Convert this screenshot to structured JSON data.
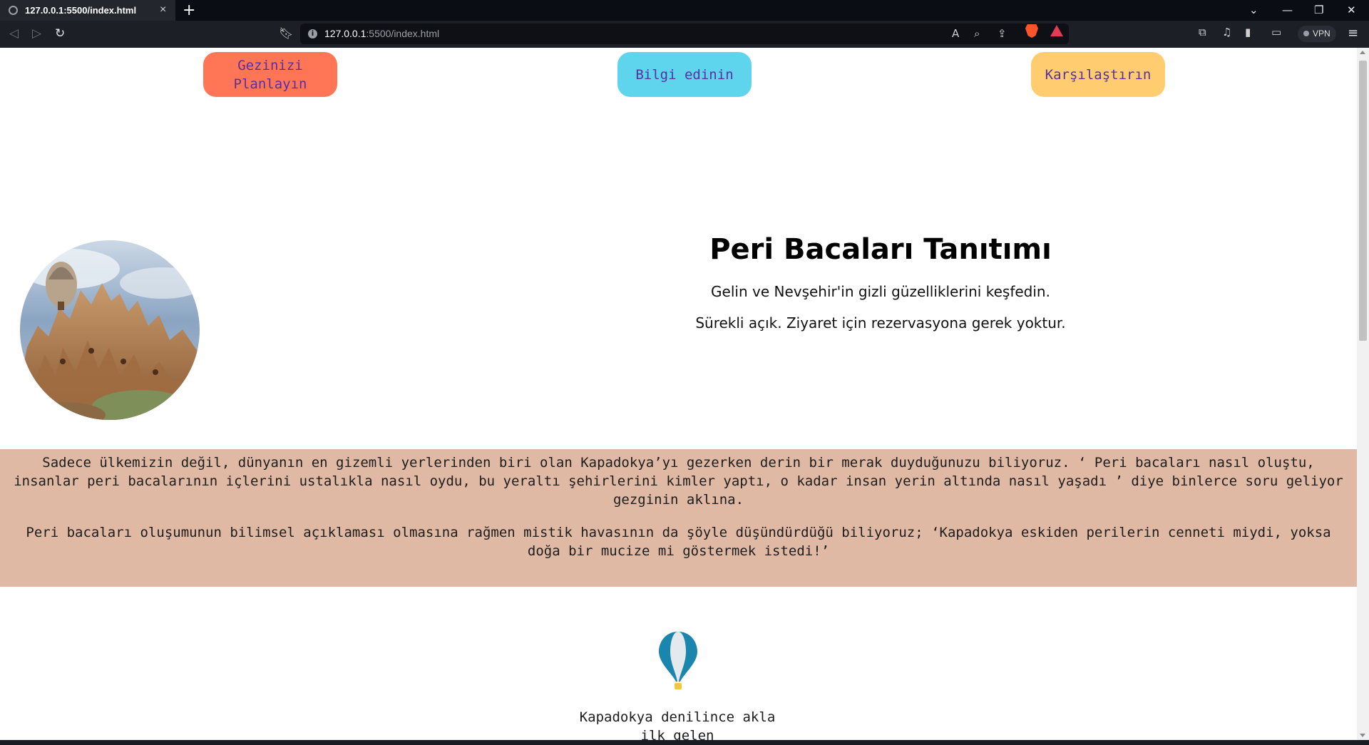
{
  "browser": {
    "tab_title": "127.0.0.1:5500/index.html",
    "tab_close": "×",
    "new_tab": "+",
    "url_host": "127.0.0.1",
    "url_rest": ":5500/index.html",
    "vpn_label": "VPN",
    "window_controls": [
      "⌄",
      "—",
      "❐",
      "✕"
    ]
  },
  "nav": {
    "plan_label": "Gezinizi Planlayın",
    "info_label": "Bilgi edinin",
    "compare_label": "Karşılaştırın",
    "colors": {
      "plan": "#ff7657",
      "info": "#5ed5ec",
      "compare": "#ffcd70",
      "text": "#5b2f9e"
    }
  },
  "hero": {
    "title": "Peri Bacaları Tanıtımı",
    "subtitle_1": "Gelin ve Nevşehir'in gizli güzelliklerini keşfedin.",
    "subtitle_2": "Sürekli açık. Ziyaret için rezervasyona gerek yoktur."
  },
  "story": {
    "paragraph_1": "Sadece ülkemizin değil, dünyanın en gizemli yerlerinden biri olan Kapadokya’yı gezerken derin bir merak duyduğunuzu biliyoruz. ‘ Peri bacaları nasıl oluştu, insanlar peri bacalarının içlerini ustalıkla nasıl oydu, bu yeraltı şehirlerini kimler yaptı, o kadar insan yerin altında nasıl yaşadı ’ diye binlerce soru geliyor gezginin aklına.",
    "paragraph_2": "Peri bacaları oluşumunun bilimsel açıklaması olmasına rağmen mistik havasının da şöyle düşündürdüğü biliyoruz; ‘Kapadokya eskiden perilerin cenneti miydi, yoksa doğa bir mucize mi göstermek istedi!’",
    "background": "#dfb9a4"
  },
  "teaser": {
    "text": "Kapadokya denilince akla ilk gelen"
  },
  "icons": {
    "balloon": "hot-air-balloon-icon"
  }
}
